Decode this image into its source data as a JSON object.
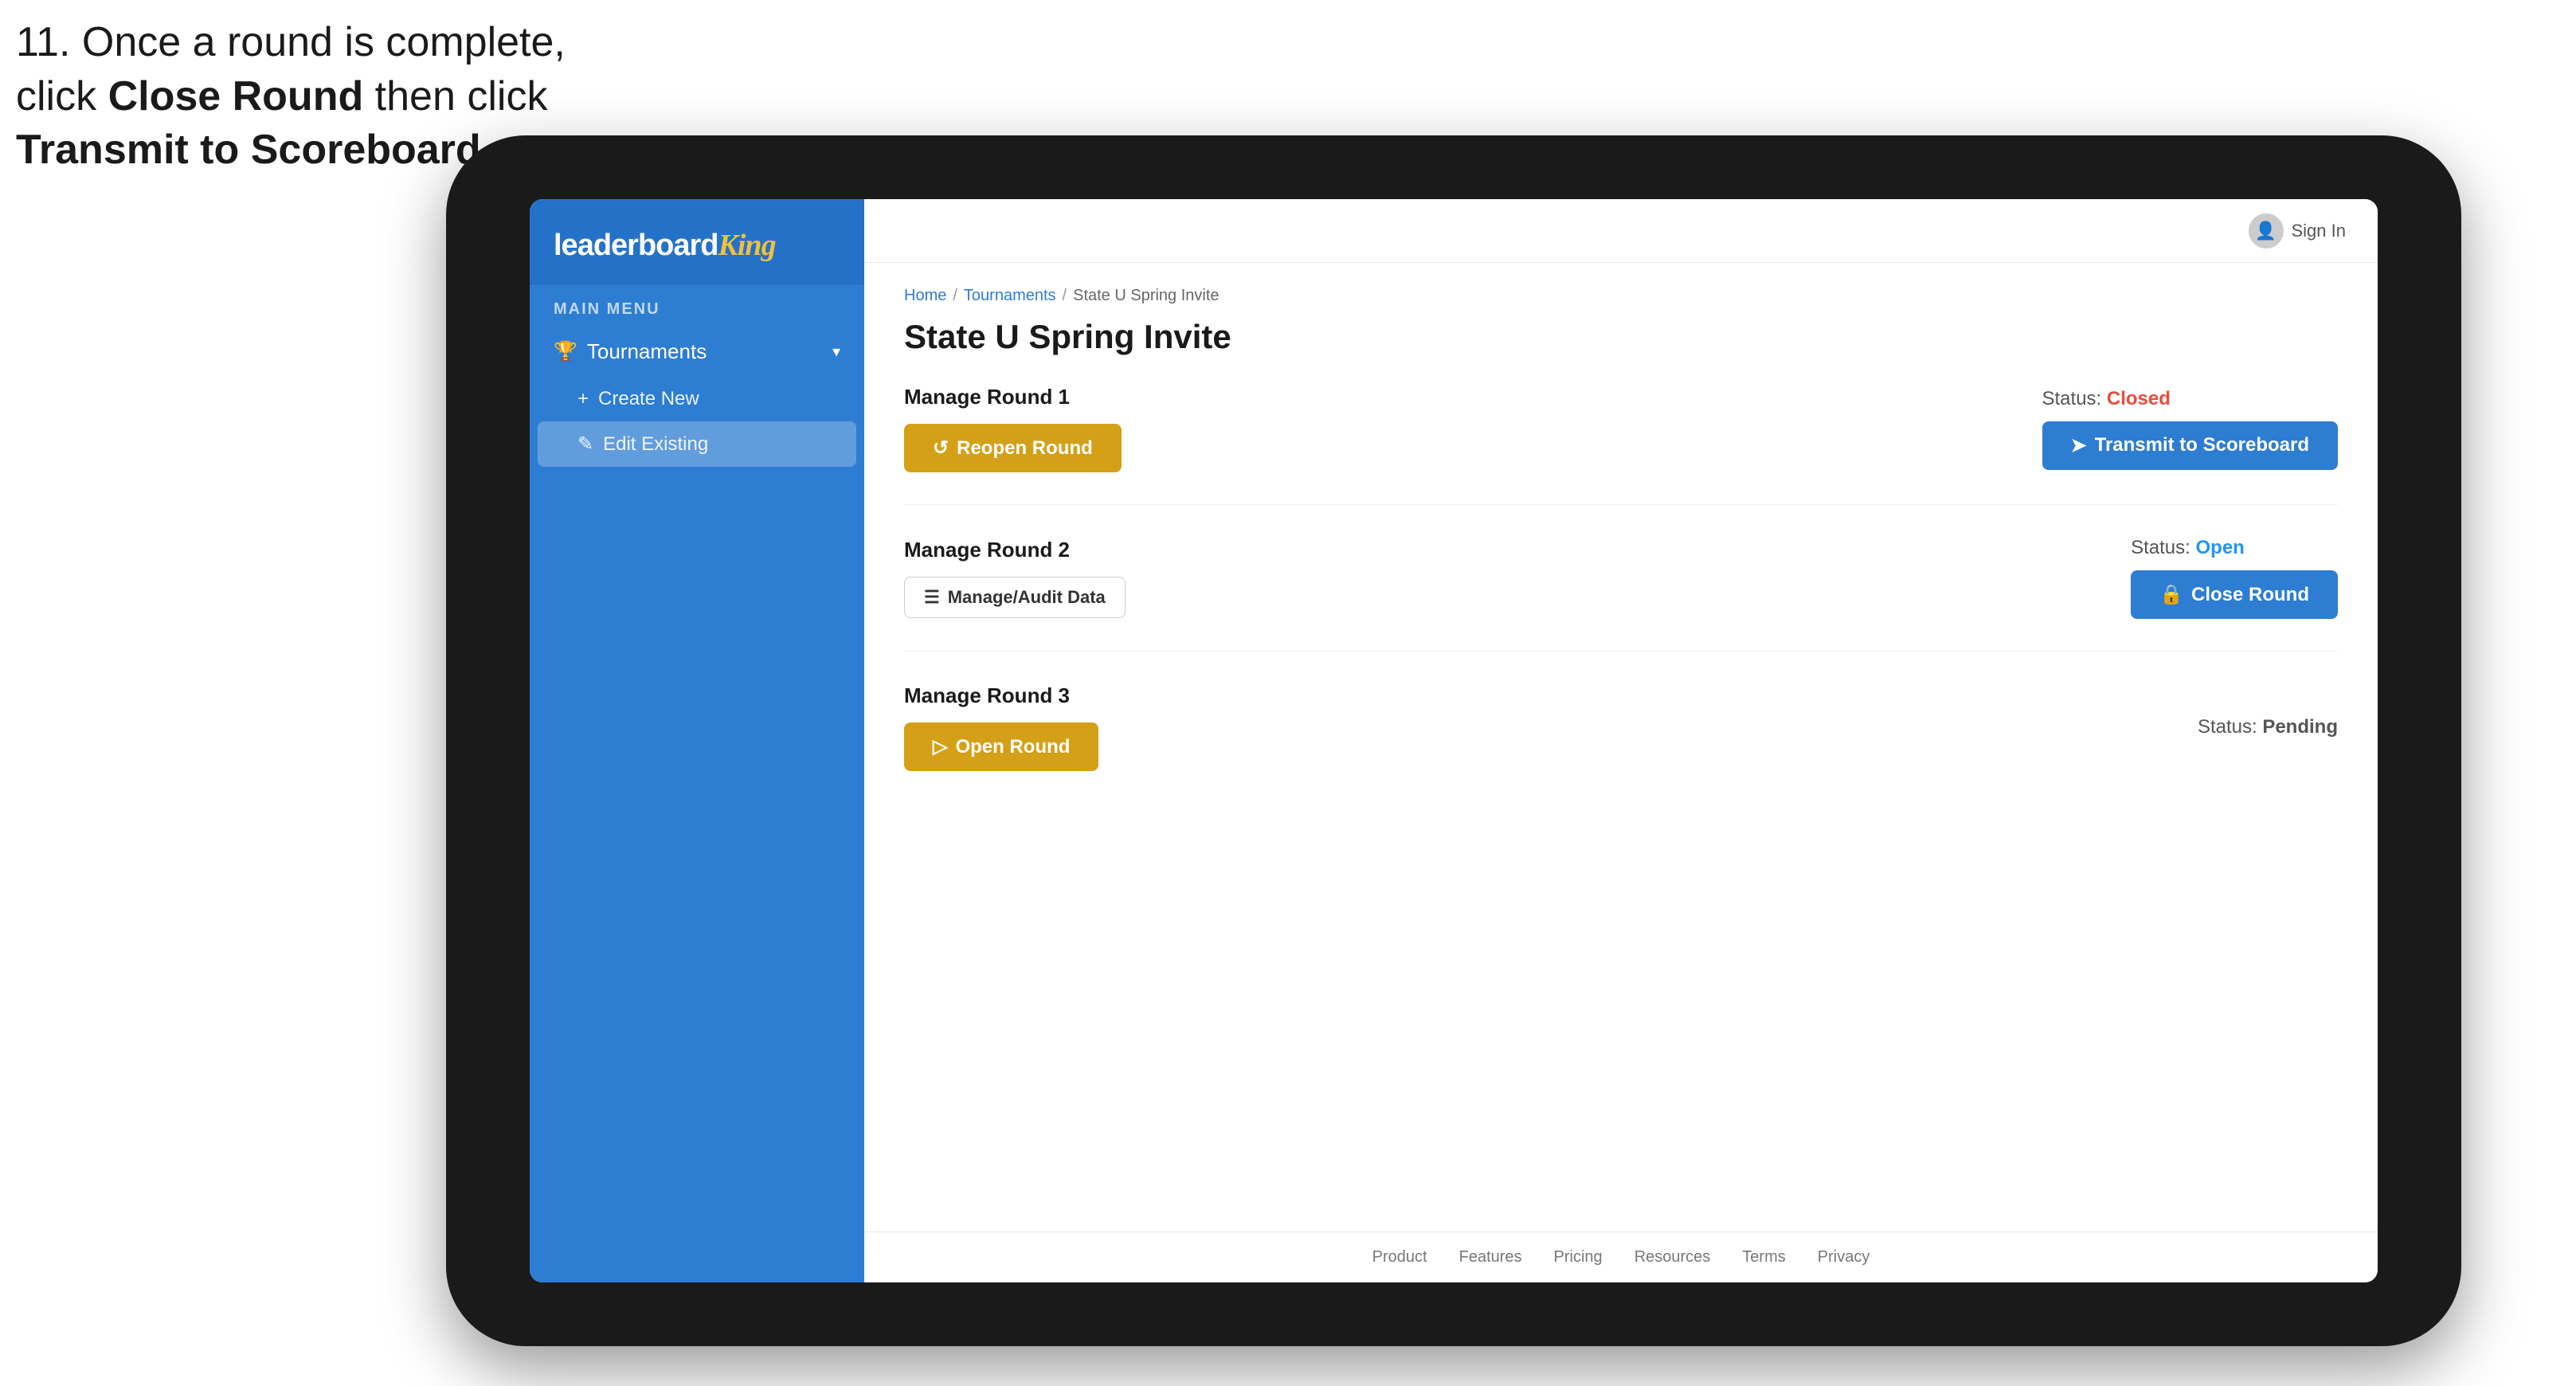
{
  "instruction": {
    "line1": "11. Once a round is complete,",
    "line2": "click ",
    "bold1": "Close Round",
    "line3": " then click",
    "bold2": "Transmit to Scoreboard."
  },
  "sidebar": {
    "logo": "leaderboard",
    "logo_king": "King",
    "menu_label": "MAIN MENU",
    "tournaments_label": "Tournaments",
    "create_new_label": "Create New",
    "edit_existing_label": "Edit Existing"
  },
  "topbar": {
    "sign_in_label": "Sign In"
  },
  "breadcrumb": {
    "home": "Home",
    "tournaments": "Tournaments",
    "current": "State U Spring Invite"
  },
  "page": {
    "title": "State U Spring Invite"
  },
  "rounds": [
    {
      "id": 1,
      "title": "Manage Round 1",
      "status_label": "Status:",
      "status_value": "Closed",
      "status_type": "closed",
      "buttons": [
        {
          "label": "Reopen Round",
          "type": "gold",
          "icon": "↺"
        },
        {
          "label": "Transmit to Scoreboard",
          "type": "blue",
          "icon": "➤"
        }
      ]
    },
    {
      "id": 2,
      "title": "Manage Round 2",
      "status_label": "Status:",
      "status_value": "Open",
      "status_type": "open",
      "buttons": [
        {
          "label": "Manage/Audit Data",
          "type": "manage",
          "icon": "☰"
        },
        {
          "label": "Close Round",
          "type": "blue",
          "icon": "🔒"
        }
      ]
    },
    {
      "id": 3,
      "title": "Manage Round 3",
      "status_label": "Status:",
      "status_value": "Pending",
      "status_type": "pending",
      "buttons": [
        {
          "label": "Open Round",
          "type": "gold",
          "icon": "▷"
        }
      ]
    }
  ],
  "footer": {
    "links": [
      "Product",
      "Features",
      "Pricing",
      "Resources",
      "Terms",
      "Privacy"
    ]
  }
}
